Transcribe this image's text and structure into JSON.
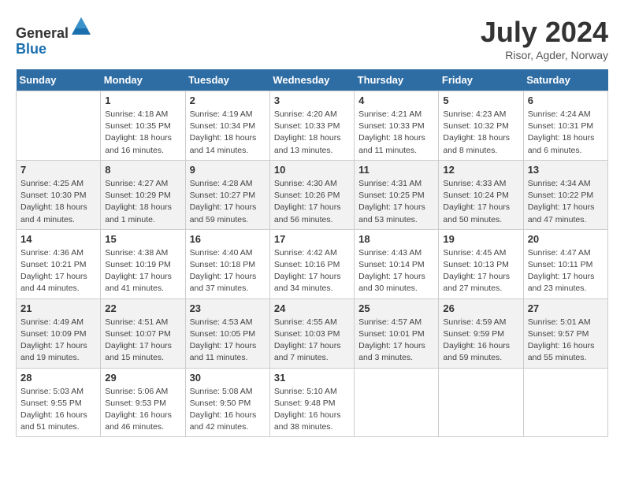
{
  "header": {
    "logo_line1": "General",
    "logo_line2": "Blue",
    "main_title": "July 2024",
    "subtitle": "Risor, Agder, Norway"
  },
  "calendar": {
    "weekdays": [
      "Sunday",
      "Monday",
      "Tuesday",
      "Wednesday",
      "Thursday",
      "Friday",
      "Saturday"
    ],
    "weeks": [
      [
        {
          "day": "",
          "info": ""
        },
        {
          "day": "1",
          "info": "Sunrise: 4:18 AM\nSunset: 10:35 PM\nDaylight: 18 hours\nand 16 minutes."
        },
        {
          "day": "2",
          "info": "Sunrise: 4:19 AM\nSunset: 10:34 PM\nDaylight: 18 hours\nand 14 minutes."
        },
        {
          "day": "3",
          "info": "Sunrise: 4:20 AM\nSunset: 10:33 PM\nDaylight: 18 hours\nand 13 minutes."
        },
        {
          "day": "4",
          "info": "Sunrise: 4:21 AM\nSunset: 10:33 PM\nDaylight: 18 hours\nand 11 minutes."
        },
        {
          "day": "5",
          "info": "Sunrise: 4:23 AM\nSunset: 10:32 PM\nDaylight: 18 hours\nand 8 minutes."
        },
        {
          "day": "6",
          "info": "Sunrise: 4:24 AM\nSunset: 10:31 PM\nDaylight: 18 hours\nand 6 minutes."
        }
      ],
      [
        {
          "day": "7",
          "info": "Sunrise: 4:25 AM\nSunset: 10:30 PM\nDaylight: 18 hours\nand 4 minutes."
        },
        {
          "day": "8",
          "info": "Sunrise: 4:27 AM\nSunset: 10:29 PM\nDaylight: 18 hours\nand 1 minute."
        },
        {
          "day": "9",
          "info": "Sunrise: 4:28 AM\nSunset: 10:27 PM\nDaylight: 17 hours\nand 59 minutes."
        },
        {
          "day": "10",
          "info": "Sunrise: 4:30 AM\nSunset: 10:26 PM\nDaylight: 17 hours\nand 56 minutes."
        },
        {
          "day": "11",
          "info": "Sunrise: 4:31 AM\nSunset: 10:25 PM\nDaylight: 17 hours\nand 53 minutes."
        },
        {
          "day": "12",
          "info": "Sunrise: 4:33 AM\nSunset: 10:24 PM\nDaylight: 17 hours\nand 50 minutes."
        },
        {
          "day": "13",
          "info": "Sunrise: 4:34 AM\nSunset: 10:22 PM\nDaylight: 17 hours\nand 47 minutes."
        }
      ],
      [
        {
          "day": "14",
          "info": "Sunrise: 4:36 AM\nSunset: 10:21 PM\nDaylight: 17 hours\nand 44 minutes."
        },
        {
          "day": "15",
          "info": "Sunrise: 4:38 AM\nSunset: 10:19 PM\nDaylight: 17 hours\nand 41 minutes."
        },
        {
          "day": "16",
          "info": "Sunrise: 4:40 AM\nSunset: 10:18 PM\nDaylight: 17 hours\nand 37 minutes."
        },
        {
          "day": "17",
          "info": "Sunrise: 4:42 AM\nSunset: 10:16 PM\nDaylight: 17 hours\nand 34 minutes."
        },
        {
          "day": "18",
          "info": "Sunrise: 4:43 AM\nSunset: 10:14 PM\nDaylight: 17 hours\nand 30 minutes."
        },
        {
          "day": "19",
          "info": "Sunrise: 4:45 AM\nSunset: 10:13 PM\nDaylight: 17 hours\nand 27 minutes."
        },
        {
          "day": "20",
          "info": "Sunrise: 4:47 AM\nSunset: 10:11 PM\nDaylight: 17 hours\nand 23 minutes."
        }
      ],
      [
        {
          "day": "21",
          "info": "Sunrise: 4:49 AM\nSunset: 10:09 PM\nDaylight: 17 hours\nand 19 minutes."
        },
        {
          "day": "22",
          "info": "Sunrise: 4:51 AM\nSunset: 10:07 PM\nDaylight: 17 hours\nand 15 minutes."
        },
        {
          "day": "23",
          "info": "Sunrise: 4:53 AM\nSunset: 10:05 PM\nDaylight: 17 hours\nand 11 minutes."
        },
        {
          "day": "24",
          "info": "Sunrise: 4:55 AM\nSunset: 10:03 PM\nDaylight: 17 hours\nand 7 minutes."
        },
        {
          "day": "25",
          "info": "Sunrise: 4:57 AM\nSunset: 10:01 PM\nDaylight: 17 hours\nand 3 minutes."
        },
        {
          "day": "26",
          "info": "Sunrise: 4:59 AM\nSunset: 9:59 PM\nDaylight: 16 hours\nand 59 minutes."
        },
        {
          "day": "27",
          "info": "Sunrise: 5:01 AM\nSunset: 9:57 PM\nDaylight: 16 hours\nand 55 minutes."
        }
      ],
      [
        {
          "day": "28",
          "info": "Sunrise: 5:03 AM\nSunset: 9:55 PM\nDaylight: 16 hours\nand 51 minutes."
        },
        {
          "day": "29",
          "info": "Sunrise: 5:06 AM\nSunset: 9:53 PM\nDaylight: 16 hours\nand 46 minutes."
        },
        {
          "day": "30",
          "info": "Sunrise: 5:08 AM\nSunset: 9:50 PM\nDaylight: 16 hours\nand 42 minutes."
        },
        {
          "day": "31",
          "info": "Sunrise: 5:10 AM\nSunset: 9:48 PM\nDaylight: 16 hours\nand 38 minutes."
        },
        {
          "day": "",
          "info": ""
        },
        {
          "day": "",
          "info": ""
        },
        {
          "day": "",
          "info": ""
        }
      ]
    ]
  }
}
